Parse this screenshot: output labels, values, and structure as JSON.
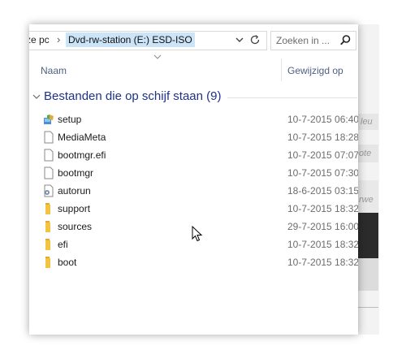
{
  "address": {
    "previous_crumb": "ze pc",
    "separator": "›",
    "current_location": "Dvd-rw-station (E:) ESD-ISO"
  },
  "search": {
    "placeholder": "Zoeken in ..."
  },
  "columns": {
    "name": "Naam",
    "date_modified": "Gewijzigd op"
  },
  "group": {
    "title": "Bestanden die op schijf staan (9)"
  },
  "files": [
    {
      "name": "setup",
      "date": "10-7-2015 06:40",
      "icon": "setup-app-icon"
    },
    {
      "name": "MediaMeta",
      "date": "10-7-2015 18:28",
      "icon": "file-icon"
    },
    {
      "name": "bootmgr.efi",
      "date": "10-7-2015 07:07",
      "icon": "file-icon"
    },
    {
      "name": "bootmgr",
      "date": "10-7-2015 07:30",
      "icon": "file-icon"
    },
    {
      "name": "autorun",
      "date": "18-6-2015 03:15",
      "icon": "autorun-settings-icon"
    },
    {
      "name": "support",
      "date": "10-7-2015 18:32",
      "icon": "folder-icon"
    },
    {
      "name": "sources",
      "date": "29-7-2015 16:00",
      "icon": "folder-icon"
    },
    {
      "name": "efi",
      "date": "10-7-2015 18:32",
      "icon": "folder-icon"
    },
    {
      "name": "boot",
      "date": "10-7-2015 18:32",
      "icon": "folder-icon"
    }
  ],
  "background_window": {
    "text_1": "leu",
    "text_2": "ote",
    "text_3": "rwe"
  },
  "colors": {
    "group_title": "#1e3287",
    "column_header": "#4d6082",
    "address_highlight": "#cce4f7",
    "folder_yellow": "#f5c342"
  }
}
